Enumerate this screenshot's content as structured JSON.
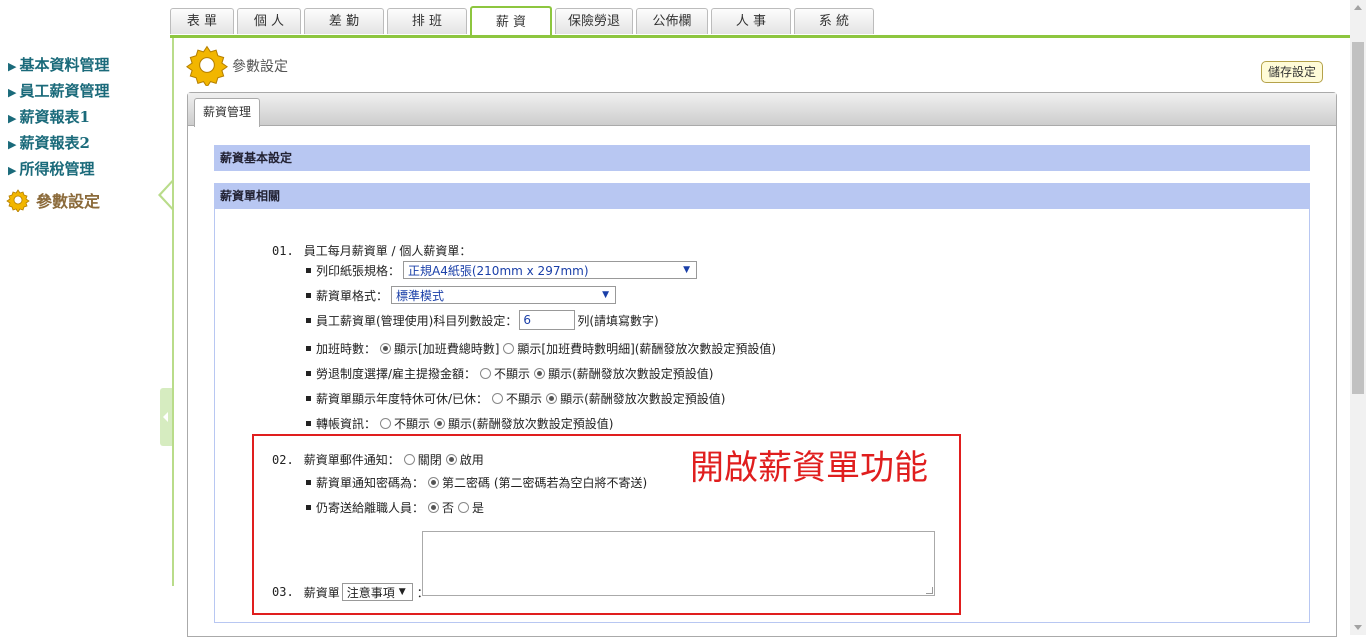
{
  "nav": {
    "tabs": [
      "表 單",
      "個 人",
      "差 勤",
      "排 班",
      "薪 資",
      "保險勞退",
      "公佈欄",
      "人 事",
      "系 統"
    ],
    "active": "薪 資"
  },
  "sidebar": {
    "items": [
      "基本資料管理",
      "員工薪資管理",
      "薪資報表1",
      "薪資報表2",
      "所得稅管理"
    ],
    "current": "參數設定"
  },
  "header": {
    "title": "參數設定",
    "save_label": "儲存設定"
  },
  "panel": {
    "tab": "薪資管理"
  },
  "sections": {
    "basic": "薪資基本設定",
    "slip": "薪資單相關"
  },
  "settings": {
    "s01": {
      "num": "01.",
      "title": "員工每月薪資單 / 個人薪資單：",
      "paper_label": "列印紙張規格：",
      "paper_value": "正規A4紙張(210mm x 297mm)",
      "format_label": "薪資單格式：",
      "format_value": "標準模式",
      "cols_label": "員工薪資單(管理使用)科目列數設定：",
      "cols_value": "6",
      "cols_hint": "列(請填寫數字)",
      "ot_label": "加班時數：",
      "ot_opt1": "顯示[加班費總時數]",
      "ot_opt2": "顯示[加班費時數明細](薪酬發放次數設定預設值)",
      "pension_label": "勞退制度選擇/雇主提撥金額：",
      "pension_opt1": "不顯示",
      "pension_opt2": "顯示(薪酬發放次數設定預設值)",
      "leave_label": "薪資單顯示年度特休可休/已休：",
      "leave_opt1": "不顯示",
      "leave_opt2": "顯示(薪酬發放次數設定預設值)",
      "transfer_label": "轉帳資訊：",
      "transfer_opt1": "不顯示",
      "transfer_opt2": "顯示(薪酬發放次數設定預設值)"
    },
    "s02": {
      "num": "02.",
      "title": "薪資單郵件通知：",
      "opt_off": "關閉",
      "opt_on": "啟用",
      "pwd_label": "薪資單通知密碼為：",
      "pwd_opt": "第二密碼 (第二密碼若為空白將不寄送)",
      "resigned_label": "仍寄送給離職人員：",
      "resigned_no": "否",
      "resigned_yes": "是"
    },
    "s03": {
      "num": "03.",
      "title": "薪資單",
      "select_value": "注意事項",
      "colon": "："
    }
  },
  "annotation": "開啟薪資單功能"
}
